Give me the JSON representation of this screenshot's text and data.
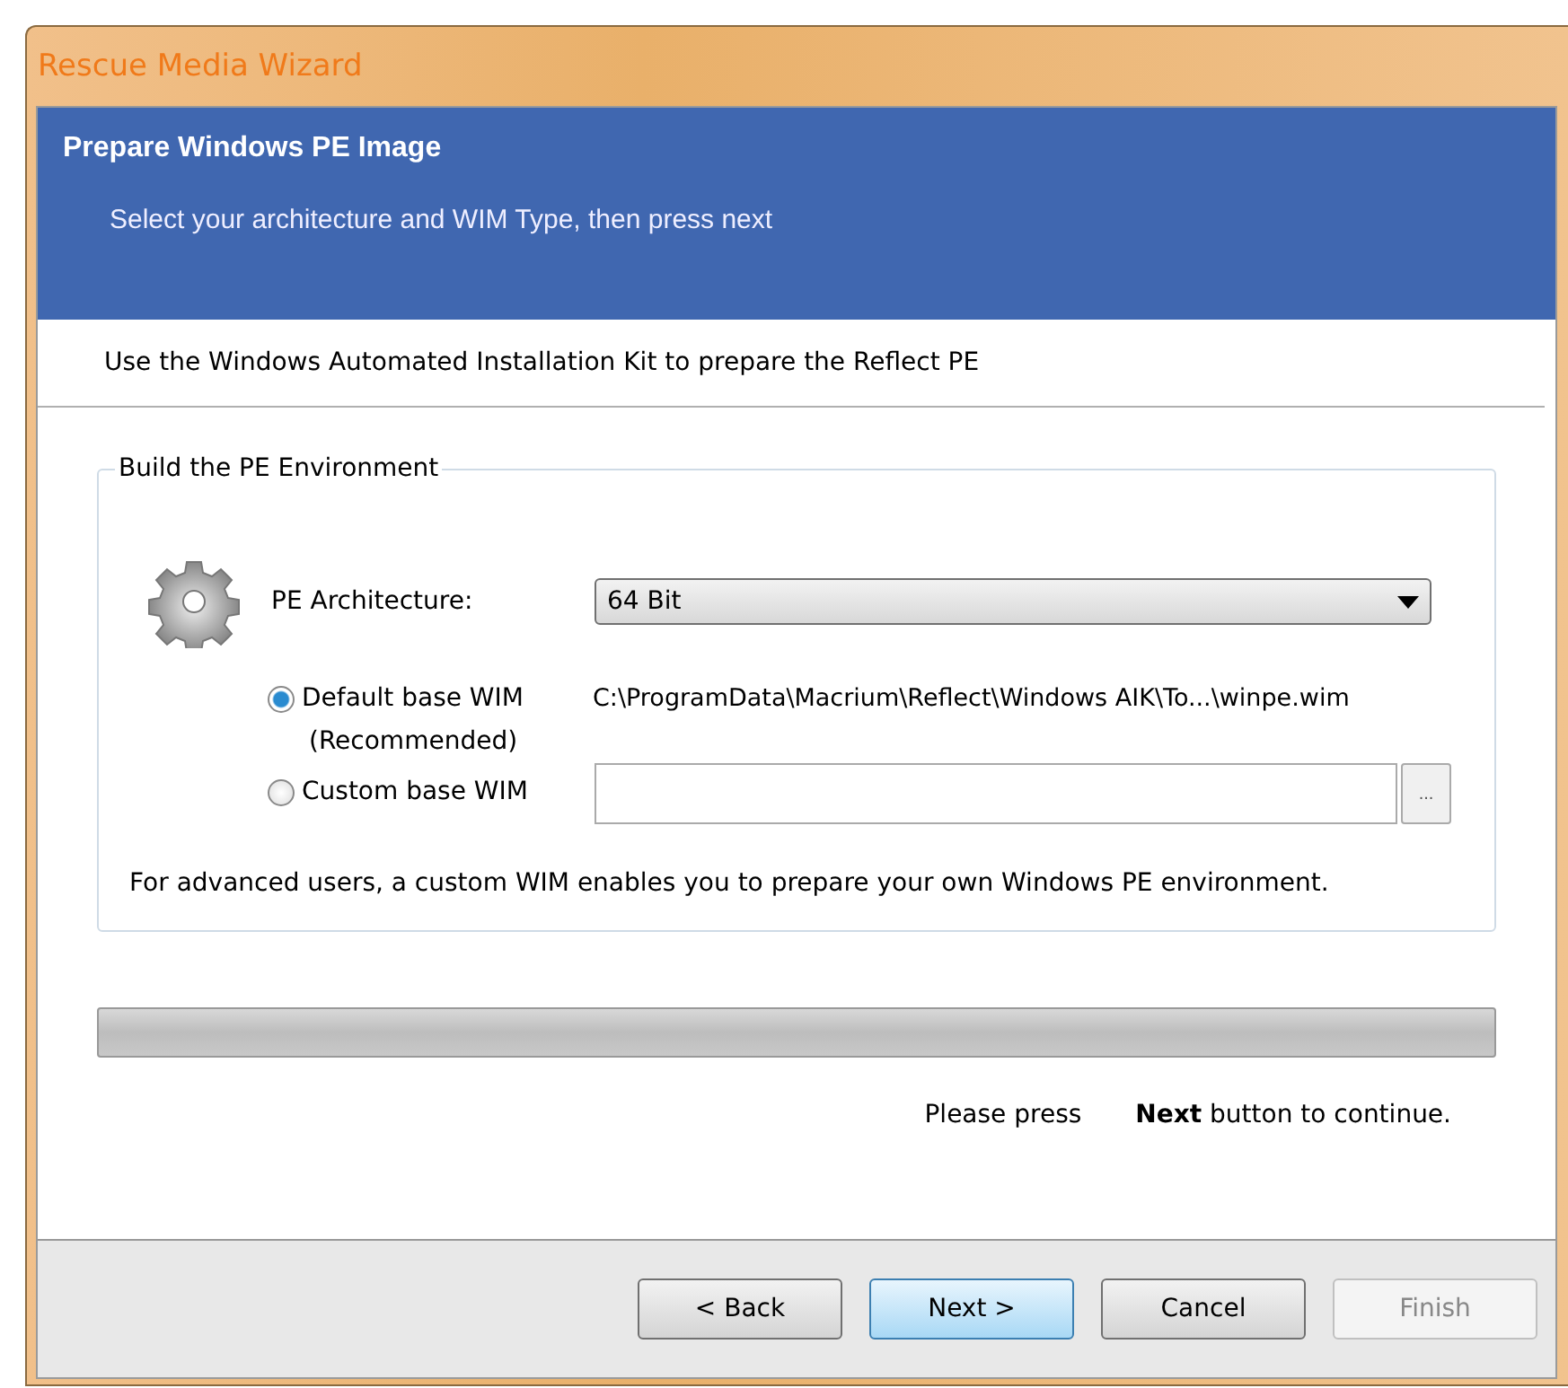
{
  "window": {
    "title": "Rescue Media Wizard"
  },
  "header": {
    "title": "Prepare Windows PE Image",
    "subtitle": "Select your architecture and WIM Type, then press next"
  },
  "intro": "Use the Windows Automated Installation Kit to prepare the Reflect PE",
  "group": {
    "title": "Build the PE Environment",
    "architecture_label": "PE Architecture:",
    "architecture_value": "64 Bit",
    "options": [
      {
        "label": "Default base WIM",
        "note": "(Recommended)",
        "selected": true,
        "kind": "text",
        "value": "C:\\ProgramData\\Macrium\\Reflect\\Windows AIK\\To...\\winpe.wim"
      },
      {
        "label": "Custom base WIM",
        "selected": false,
        "kind": "field",
        "browse": "..."
      }
    ],
    "hint": "For advanced users, a custom WIM enables you to prepare your own Windows PE environment."
  },
  "progress": {
    "level": 0
  },
  "status": {
    "prefix": "Please press",
    "message": "**Next** button to continue."
  },
  "buttons": [
    {
      "label": "< Back",
      "default": false,
      "disabled": false
    },
    {
      "label": "Next >",
      "default": true,
      "disabled": false
    },
    {
      "label": "Cancel",
      "default": false,
      "disabled": false
    },
    {
      "label": "Finish",
      "default": false,
      "disabled": true
    }
  ]
}
